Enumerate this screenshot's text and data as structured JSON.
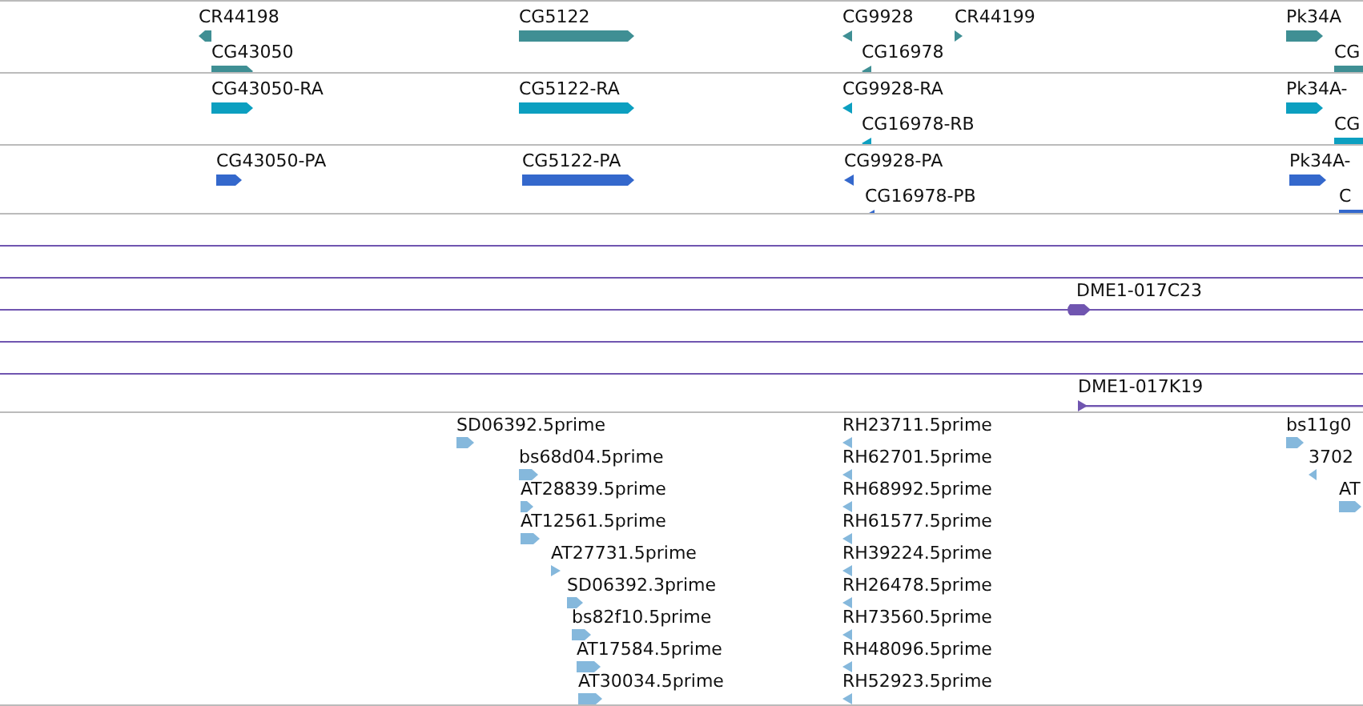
{
  "tracks": [
    {
      "kind": "gene",
      "features": [
        {
          "label": "CR44198",
          "reverse": true
        },
        {
          "label": "CG43050",
          "reverse": false
        },
        {
          "label": "CG5122",
          "reverse": false
        },
        {
          "label": "CG9928",
          "reverse": true
        },
        {
          "label": "CR44199",
          "reverse": false
        },
        {
          "label": "CG16978",
          "reverse": true
        },
        {
          "label": "Pk34A",
          "reverse": false
        },
        {
          "label": "CG",
          "reverse": false
        }
      ]
    },
    {
      "kind": "transcript",
      "features": [
        {
          "label": "CG43050-RA",
          "reverse": false
        },
        {
          "label": "CG5122-RA",
          "reverse": false
        },
        {
          "label": "CG9928-RA",
          "reverse": true
        },
        {
          "label": "CG16978-RB",
          "reverse": true
        },
        {
          "label": "Pk34A-",
          "reverse": false
        },
        {
          "label": "CG",
          "reverse": false
        }
      ]
    },
    {
      "kind": "protein",
      "features": [
        {
          "label": "CG43050-PA",
          "reverse": false
        },
        {
          "label": "CG5122-PA",
          "reverse": false
        },
        {
          "label": "CG9928-PA",
          "reverse": true
        },
        {
          "label": "CG16978-PB",
          "reverse": true
        },
        {
          "label": "Pk34A-",
          "reverse": false
        },
        {
          "label": "C",
          "reverse": false
        }
      ]
    },
    {
      "kind": "clone",
      "features": [
        {
          "label": "DME1-017C23",
          "reverse": false
        },
        {
          "label": "DME1-017K19",
          "reverse": false
        }
      ]
    },
    {
      "kind": "est",
      "features": [
        {
          "label": "SD06392.5prime",
          "reverse": false
        },
        {
          "label": "bs68d04.5prime",
          "reverse": false
        },
        {
          "label": "AT28839.5prime",
          "reverse": false
        },
        {
          "label": "AT12561.5prime",
          "reverse": false
        },
        {
          "label": "AT27731.5prime",
          "reverse": false
        },
        {
          "label": "SD06392.3prime",
          "reverse": false
        },
        {
          "label": "bs82f10.5prime",
          "reverse": false
        },
        {
          "label": "AT17584.5prime",
          "reverse": false
        },
        {
          "label": "AT30034.5prime",
          "reverse": false
        },
        {
          "label": "RH23711.5prime",
          "reverse": true
        },
        {
          "label": "RH62701.5prime",
          "reverse": true
        },
        {
          "label": "RH68992.5prime",
          "reverse": true
        },
        {
          "label": "RH61577.5prime",
          "reverse": true
        },
        {
          "label": "RH39224.5prime",
          "reverse": true
        },
        {
          "label": "RH26478.5prime",
          "reverse": true
        },
        {
          "label": "RH73560.5prime",
          "reverse": true
        },
        {
          "label": "RH48096.5prime",
          "reverse": true
        },
        {
          "label": "RH52923.5prime",
          "reverse": true
        },
        {
          "label": "bs11g0",
          "reverse": false
        },
        {
          "label": "3702",
          "reverse": true
        },
        {
          "label": "AT",
          "reverse": false
        }
      ]
    }
  ]
}
